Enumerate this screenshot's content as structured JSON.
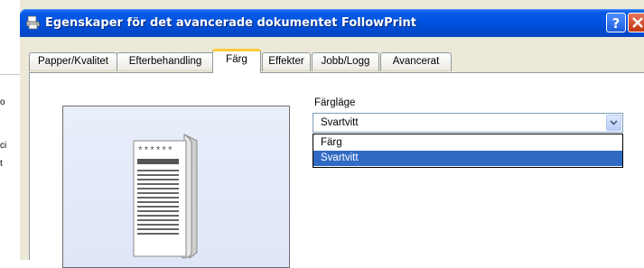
{
  "background_window": {
    "glyphs": [
      "o",
      "ci",
      "t"
    ]
  },
  "dialog": {
    "title": "Egenskaper för det avancerade dokumentet FollowPrint",
    "help_label": "?",
    "icon": "printer-icon",
    "tabs": [
      {
        "label": "Papper/Kvalitet",
        "active": false
      },
      {
        "label": "Efterbehandling",
        "active": false
      },
      {
        "label": "Färg",
        "active": true
      },
      {
        "label": "Effekter",
        "active": false
      },
      {
        "label": "Jobb/Logg",
        "active": false
      },
      {
        "label": "Avancerat",
        "active": false
      }
    ],
    "color_mode": {
      "label": "Färgläge",
      "value": "Svartvitt",
      "options": [
        {
          "label": "Färg",
          "selected": false
        },
        {
          "label": "Svartvitt",
          "selected": true
        }
      ]
    },
    "preview": {
      "doc_header": "******"
    }
  },
  "colors": {
    "titlebar": "#0052e0",
    "selection": "#316ac5",
    "active_tab_accent": "#ffc83c",
    "dialog_face": "#ece9d8"
  }
}
